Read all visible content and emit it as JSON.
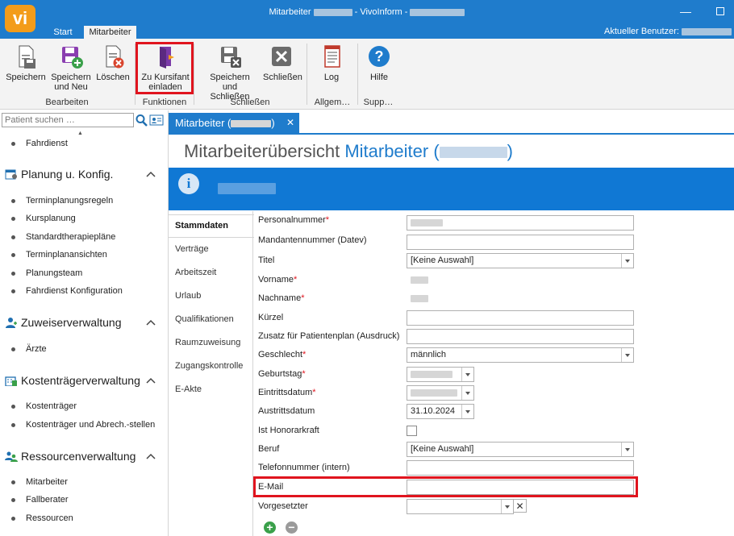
{
  "window": {
    "logo_text": "vi",
    "title_prefix": "Mitarbeiter",
    "title_middle": "- VivoInform -",
    "current_user_label": "Aktueller Benutzer:",
    "minimize_glyph": "—"
  },
  "tabs": [
    {
      "label": "Start"
    },
    {
      "label": "Mitarbeiter"
    }
  ],
  "ribbon": {
    "buttons": {
      "save": "Speichern",
      "save_new_1": "Speichern",
      "save_new_2": "und Neu",
      "delete": "Löschen",
      "invite_1": "Zu Kursifant",
      "invite_2": "einladen",
      "save_close_1": "Speichern und",
      "save_close_2": "Schließen",
      "close": "Schließen",
      "log": "Log",
      "help": "Hilfe"
    },
    "groups": {
      "edit": "Bearbeiten",
      "functions": "Funktionen",
      "close": "Schließen",
      "general": "Allgem…",
      "support": "Supp…"
    },
    "highlight_color": "#e0141e"
  },
  "sidebar": {
    "search_placeholder": "Patient suchen …",
    "top_item": "Fahrdienst",
    "sections": [
      {
        "title": "Planung u. Konfig.",
        "icon": "calendar-gear-icon",
        "items": [
          "Terminplanungsregeln",
          "Kursplanung",
          "Standardtherapiepläne",
          "Terminplanansichten",
          "Planungsteam",
          "Fahrdienst Konfiguration"
        ]
      },
      {
        "title": "Zuweiserverwaltung",
        "icon": "doctor-icon",
        "items": [
          "Ärzte"
        ]
      },
      {
        "title": "Kostenträgerverwaltung",
        "icon": "building-icon",
        "items": [
          "Kostenträger",
          "Kostenträger und Abrech.-stellen"
        ]
      },
      {
        "title": "Ressourcenverwaltung",
        "icon": "people-icon",
        "items": [
          "Mitarbeiter",
          "Fallberater",
          "Ressourcen"
        ]
      }
    ]
  },
  "document": {
    "tab_label_prefix": "Mitarbeiter (",
    "tab_label_suffix": ")",
    "close_glyph": "✕",
    "heading_main": "Mitarbeiterübersicht",
    "heading_accent_prefix": "Mitarbeiter (",
    "heading_accent_suffix": ")",
    "info_glyph": "i"
  },
  "vtabs": [
    "Stammdaten",
    "Verträge",
    "Arbeitszeit",
    "Urlaub",
    "Qualifikationen",
    "Raumzuweisung",
    "Zugangskontrolle",
    "E-Akte"
  ],
  "form": {
    "personalnummer": "Personalnummer",
    "mandantennummer": "Mandantennummer (Datev)",
    "titel": "Titel",
    "titel_value": "[Keine Auswahl]",
    "vorname": "Vorname",
    "nachname": "Nachname",
    "kuerzel": "Kürzel",
    "zusatz": "Zusatz für Patientenplan (Ausdruck)",
    "geschlecht": "Geschlecht",
    "geschlecht_value": "männlich",
    "geburtstag": "Geburtstag",
    "eintrittsdatum": "Eintrittsdatum",
    "austrittsdatum": "Austrittsdatum",
    "austrittsdatum_value": "31.10.2024",
    "honorarkraft": "Ist Honorarkraft",
    "beruf": "Beruf",
    "beruf_value": "[Keine Auswahl]",
    "telefon": "Telefonnummer (intern)",
    "email": "E-Mail",
    "vorgesetzter": "Vorgesetzter",
    "required_mark": "*",
    "clear_glyph": "✕",
    "add_glyph": "+",
    "remove_glyph": "−"
  }
}
